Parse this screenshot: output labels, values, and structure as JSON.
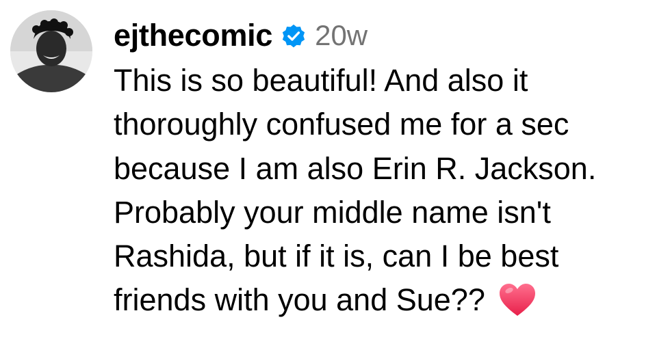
{
  "comment": {
    "avatar_icon": "profile-photo",
    "username": "ejthecomic",
    "verified_icon": "verified-badge-icon",
    "timestamp": "20w",
    "lines": [
      "This is so beautiful! And also it",
      "thoroughly confused me for a sec",
      "because I am also Erin R. Jackson.",
      "Probably your middle name isn't",
      "Rashida, but if it is, can I be best",
      "friends with you and Sue??"
    ],
    "trailing_emoji_icon": "red-heart-emoji",
    "colors": {
      "username": "#000000",
      "timestamp": "#737373",
      "verified_badge": "#0095f6",
      "heart": "#f23a5f"
    }
  }
}
